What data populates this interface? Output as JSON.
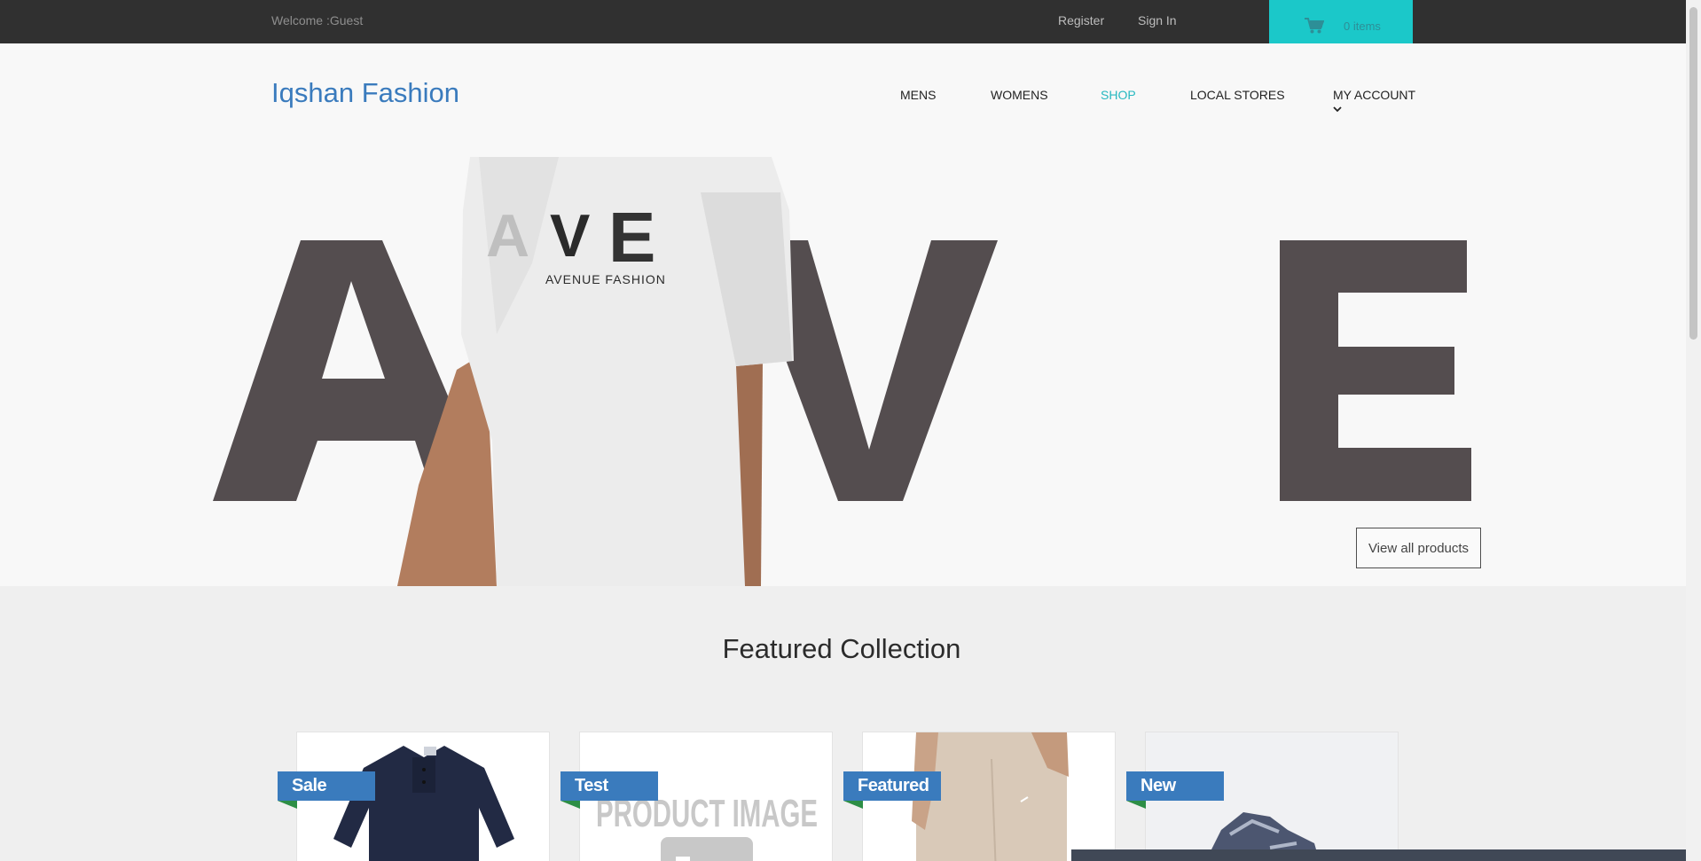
{
  "topbar": {
    "welcome": "Welcome :Guest",
    "register": "Register",
    "sign_in": "Sign In",
    "cart_label": "0 items",
    "cart_icon": "cart-icon"
  },
  "header": {
    "brand": "Iqshan Fashion",
    "nav": [
      "MENS",
      "WOMENS",
      "SHOP",
      "LOCAL STORES",
      "MY ACCOUNT"
    ],
    "active_nav": "SHOP"
  },
  "hero": {
    "letters": [
      "A",
      "V",
      "E"
    ],
    "shirt_print_letters": [
      "A",
      "V",
      "E"
    ],
    "shirt_print_text": "AVENUE FASHION",
    "view_all": "View all products"
  },
  "featured": {
    "title": "Featured Collection",
    "products": [
      {
        "badge": "Sale",
        "image": "navy-polo-shirt"
      },
      {
        "badge": "Test",
        "image": "product-image-placeholder",
        "placeholder_text": "PRODUCT IMAGE"
      },
      {
        "badge": "Featured",
        "image": "beige-sweatpants"
      },
      {
        "badge": "New",
        "image": "grey-sneaker"
      }
    ]
  },
  "colors": {
    "topbar": "#303030",
    "brand": "#3a7bbd",
    "accent": "#1bc8c9",
    "hero_letters": "#544d4f",
    "badge": "#3a7bbd"
  }
}
